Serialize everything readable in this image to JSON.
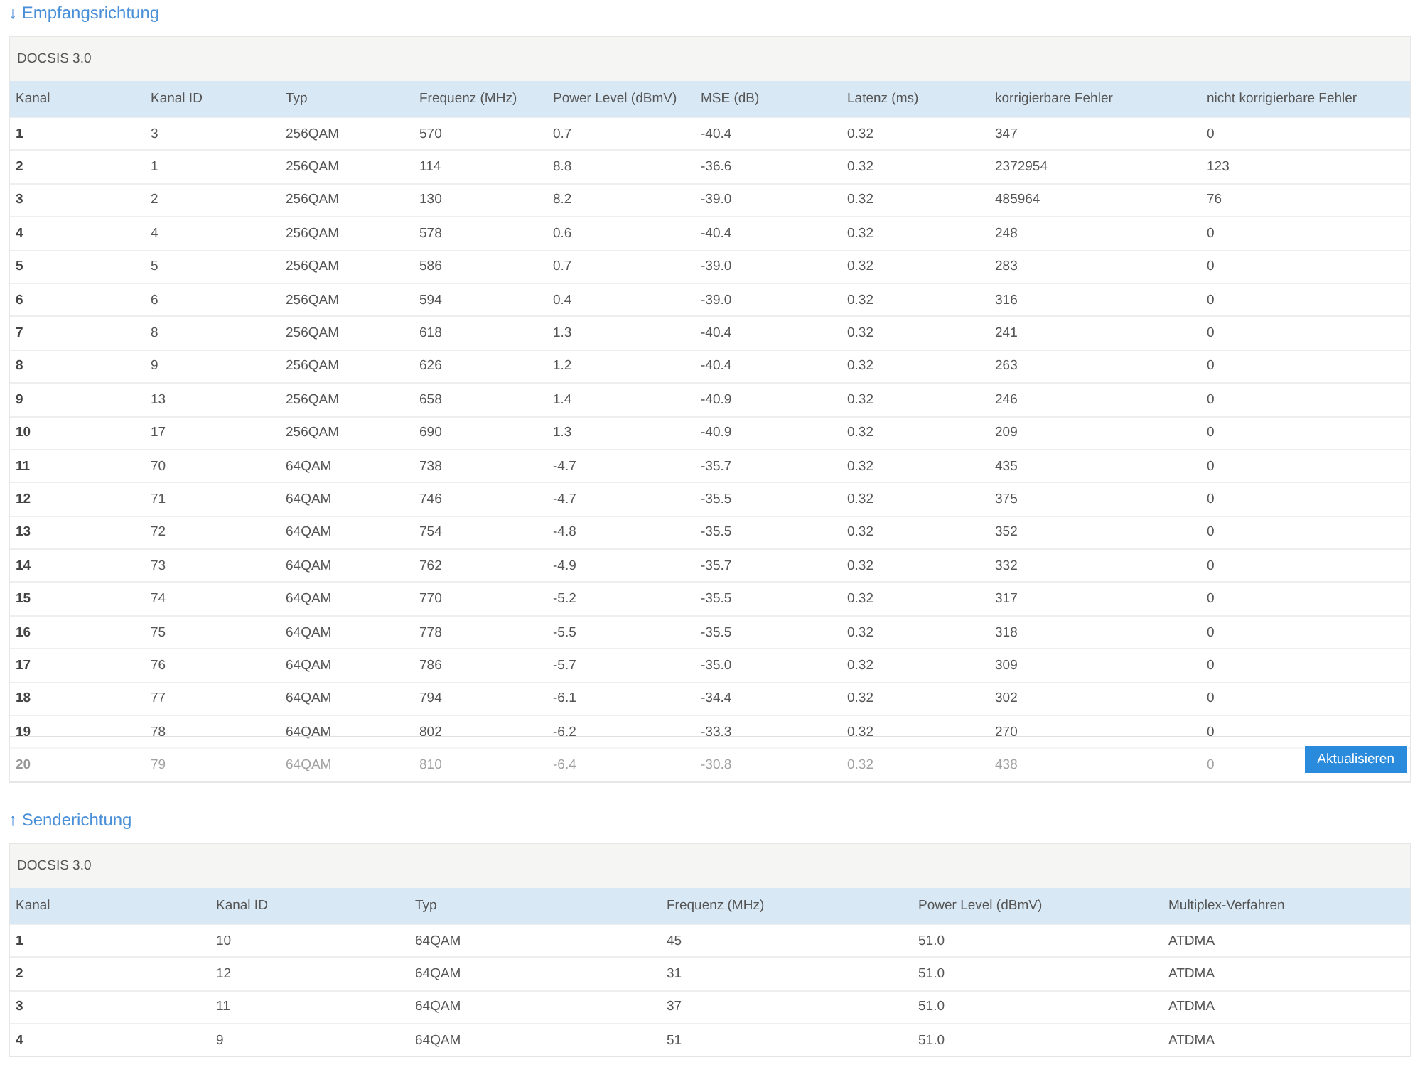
{
  "sections": [
    {
      "heading": "↓ Empfangsrichtung",
      "caption": "DOCSIS 3.0",
      "columns": [
        "Kanal",
        "Kanal ID",
        "Typ",
        "Frequenz (MHz)",
        "Power Level (dBmV)",
        "MSE (dB)",
        "Latenz (ms)",
        "korrigierbare Fehler",
        "nicht korrigierbare Fehler"
      ],
      "rows": [
        [
          "1",
          "3",
          "256QAM",
          "570",
          "0.7",
          "-40.4",
          "0.32",
          "347",
          "0"
        ],
        [
          "2",
          "1",
          "256QAM",
          "114",
          "8.8",
          "-36.6",
          "0.32",
          "2372954",
          "123"
        ],
        [
          "3",
          "2",
          "256QAM",
          "130",
          "8.2",
          "-39.0",
          "0.32",
          "485964",
          "76"
        ],
        [
          "4",
          "4",
          "256QAM",
          "578",
          "0.6",
          "-40.4",
          "0.32",
          "248",
          "0"
        ],
        [
          "5",
          "5",
          "256QAM",
          "586",
          "0.7",
          "-39.0",
          "0.32",
          "283",
          "0"
        ],
        [
          "6",
          "6",
          "256QAM",
          "594",
          "0.4",
          "-39.0",
          "0.32",
          "316",
          "0"
        ],
        [
          "7",
          "8",
          "256QAM",
          "618",
          "1.3",
          "-40.4",
          "0.32",
          "241",
          "0"
        ],
        [
          "8",
          "9",
          "256QAM",
          "626",
          "1.2",
          "-40.4",
          "0.32",
          "263",
          "0"
        ],
        [
          "9",
          "13",
          "256QAM",
          "658",
          "1.4",
          "-40.9",
          "0.32",
          "246",
          "0"
        ],
        [
          "10",
          "17",
          "256QAM",
          "690",
          "1.3",
          "-40.9",
          "0.32",
          "209",
          "0"
        ],
        [
          "11",
          "70",
          "64QAM",
          "738",
          "-4.7",
          "-35.7",
          "0.32",
          "435",
          "0"
        ],
        [
          "12",
          "71",
          "64QAM",
          "746",
          "-4.7",
          "-35.5",
          "0.32",
          "375",
          "0"
        ],
        [
          "13",
          "72",
          "64QAM",
          "754",
          "-4.8",
          "-35.5",
          "0.32",
          "352",
          "0"
        ],
        [
          "14",
          "73",
          "64QAM",
          "762",
          "-4.9",
          "-35.7",
          "0.32",
          "332",
          "0"
        ],
        [
          "15",
          "74",
          "64QAM",
          "770",
          "-5.2",
          "-35.5",
          "0.32",
          "317",
          "0"
        ],
        [
          "16",
          "75",
          "64QAM",
          "778",
          "-5.5",
          "-35.5",
          "0.32",
          "318",
          "0"
        ],
        [
          "17",
          "76",
          "64QAM",
          "786",
          "-5.7",
          "-35.0",
          "0.32",
          "309",
          "0"
        ],
        [
          "18",
          "77",
          "64QAM",
          "794",
          "-6.1",
          "-34.4",
          "0.32",
          "302",
          "0"
        ],
        [
          "19",
          "78",
          "64QAM",
          "802",
          "-6.2",
          "-33.3",
          "0.32",
          "270",
          "0"
        ],
        [
          "20",
          "79",
          "64QAM",
          "810",
          "-6.4",
          "-30.8",
          "0.32",
          "438",
          "0"
        ]
      ],
      "button": "Aktualisieren"
    },
    {
      "heading": "↑ Senderichtung",
      "caption": "DOCSIS 3.0",
      "columns": [
        "Kanal",
        "Kanal ID",
        "Typ",
        "Frequenz (MHz)",
        "Power Level (dBmV)",
        "Multiplex-Verfahren"
      ],
      "rows": [
        [
          "1",
          "10",
          "64QAM",
          "45",
          "51.0",
          "ATDMA"
        ],
        [
          "2",
          "12",
          "64QAM",
          "31",
          "51.0",
          "ATDMA"
        ],
        [
          "3",
          "11",
          "64QAM",
          "37",
          "51.0",
          "ATDMA"
        ],
        [
          "4",
          "9",
          "64QAM",
          "51",
          "51.0",
          "ATDMA"
        ]
      ]
    }
  ]
}
